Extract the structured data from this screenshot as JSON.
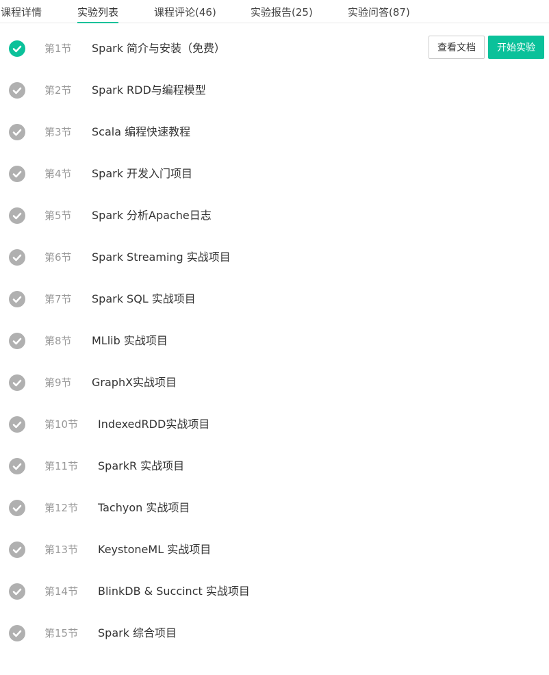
{
  "tabs": [
    {
      "label": "课程详情",
      "active": false
    },
    {
      "label": "实验列表",
      "active": true
    },
    {
      "label": "课程评论(46)",
      "active": false
    },
    {
      "label": "实验报告(25)",
      "active": false
    },
    {
      "label": "实验问答(87)",
      "active": false
    }
  ],
  "colors": {
    "accent": "#0bc19a",
    "check_inactive": "#b0b0b0",
    "section_text": "#999999"
  },
  "actions": {
    "view_doc_label": "查看文档",
    "start_label": "开始实验"
  },
  "sections": [
    {
      "num": "第1节",
      "title": "Spark 简介与安装（免费）",
      "done": true
    },
    {
      "num": "第2节",
      "title": "Spark RDD与编程模型",
      "done": false
    },
    {
      "num": "第3节",
      "title": "Scala 编程快速教程",
      "done": false
    },
    {
      "num": "第4节",
      "title": "Spark 开发入门项目",
      "done": false
    },
    {
      "num": "第5节",
      "title": "Spark 分析Apache日志",
      "done": false
    },
    {
      "num": "第6节",
      "title": "Spark Streaming 实战项目",
      "done": false
    },
    {
      "num": "第7节",
      "title": "Spark SQL 实战项目",
      "done": false
    },
    {
      "num": "第8节",
      "title": "MLlib 实战项目",
      "done": false
    },
    {
      "num": "第9节",
      "title": "GraphX实战项目",
      "done": false
    },
    {
      "num": "第10节",
      "title": "IndexedRDD实战项目",
      "done": false
    },
    {
      "num": "第11节",
      "title": "SparkR 实战项目",
      "done": false
    },
    {
      "num": "第12节",
      "title": "Tachyon 实战项目",
      "done": false
    },
    {
      "num": "第13节",
      "title": "KeystoneML 实战项目",
      "done": false
    },
    {
      "num": "第14节",
      "title": "BlinkDB & Succinct 实战项目",
      "done": false
    },
    {
      "num": "第15节",
      "title": "Spark 综合项目",
      "done": false
    }
  ]
}
